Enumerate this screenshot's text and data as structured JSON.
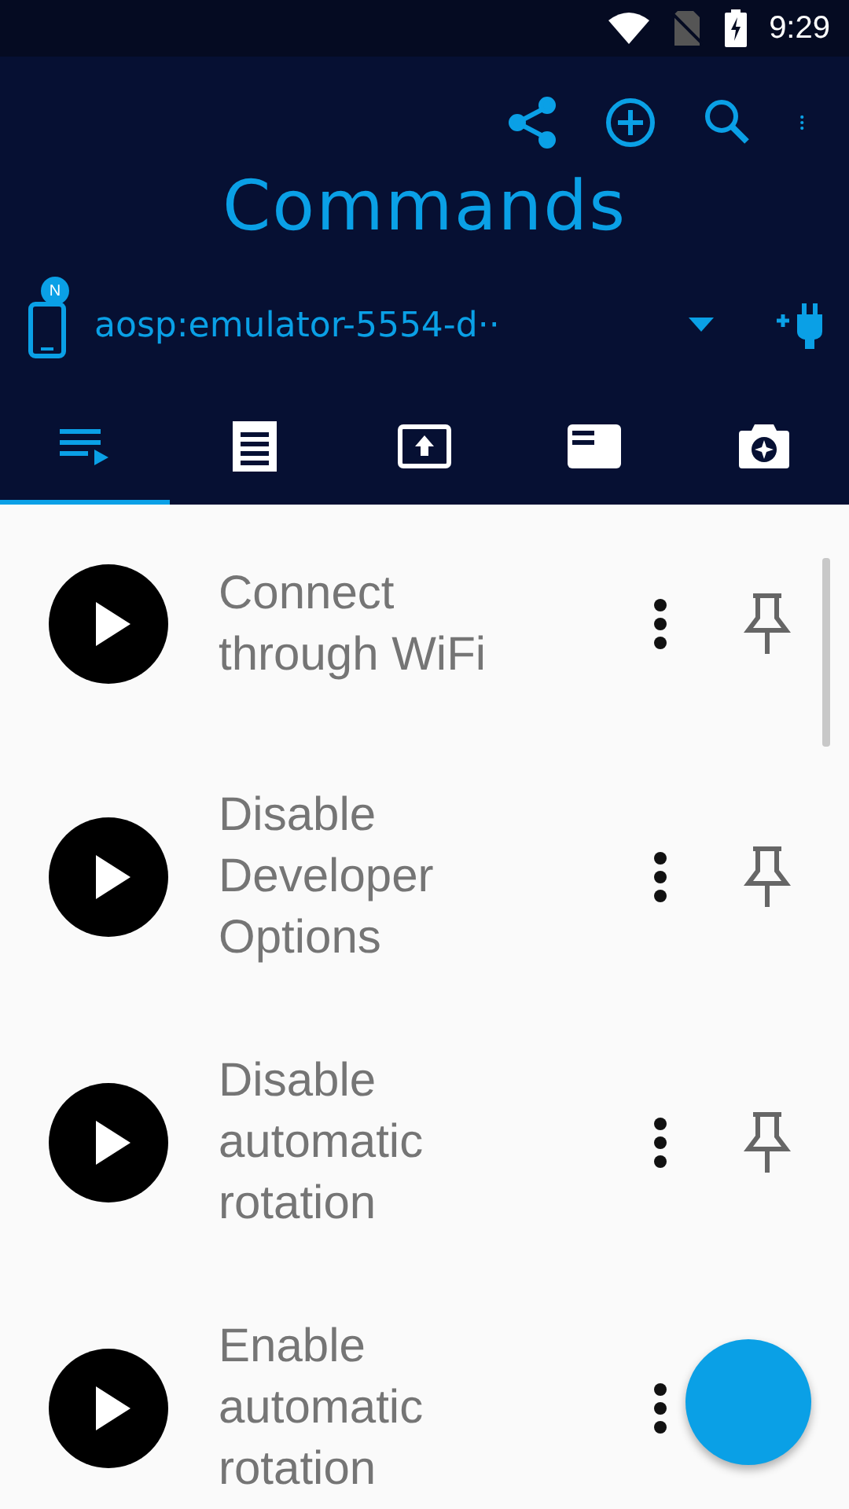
{
  "status_bar": {
    "time": "9:29"
  },
  "toolbar": {
    "title": "Commands"
  },
  "device": {
    "name": "aosp:emulator-5554-d··",
    "badge": "N"
  },
  "tabs": [
    {
      "selected": true
    },
    {
      "selected": false
    },
    {
      "selected": false
    },
    {
      "selected": false
    },
    {
      "selected": false
    }
  ],
  "commands": [
    {
      "label": "Connect through WiFi"
    },
    {
      "label": "Disable Developer Options"
    },
    {
      "label": "Disable automatic rotation"
    },
    {
      "label": "Enable automatic rotation"
    }
  ]
}
